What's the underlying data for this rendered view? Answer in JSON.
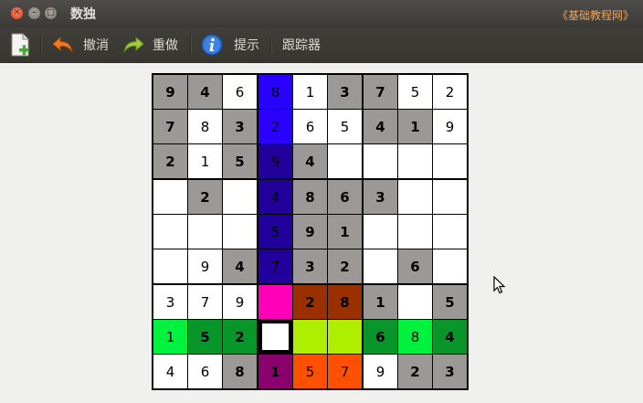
{
  "window": {
    "title": "数独",
    "link": "《基础教程网》"
  },
  "toolbar": {
    "undo_label": "撤消",
    "redo_label": "重做",
    "hint_label": "提示",
    "tracker_label": "跟踪器"
  },
  "icons": {
    "new": "new-document-icon",
    "undo": "undo-arrow-icon",
    "redo": "redo-arrow-icon",
    "hint": "info-icon"
  },
  "board": {
    "selected": [
      7,
      3
    ],
    "rows": [
      [
        {
          "v": "9",
          "g": true,
          "c": "#9c9895"
        },
        {
          "v": "4",
          "g": true,
          "c": "#9c9895"
        },
        {
          "v": "6",
          "g": false,
          "c": "#ffffff"
        },
        {
          "v": "8",
          "g": false,
          "c": "#2a00ff"
        },
        {
          "v": "1",
          "g": false,
          "c": "#ffffff"
        },
        {
          "v": "3",
          "g": true,
          "c": "#9c9895"
        },
        {
          "v": "7",
          "g": true,
          "c": "#9c9895"
        },
        {
          "v": "5",
          "g": false,
          "c": "#ffffff"
        },
        {
          "v": "2",
          "g": false,
          "c": "#ffffff"
        }
      ],
      [
        {
          "v": "7",
          "g": true,
          "c": "#9c9895"
        },
        {
          "v": "8",
          "g": false,
          "c": "#ffffff"
        },
        {
          "v": "3",
          "g": true,
          "c": "#9c9895"
        },
        {
          "v": "2",
          "g": false,
          "c": "#2a00ff"
        },
        {
          "v": "6",
          "g": false,
          "c": "#ffffff"
        },
        {
          "v": "5",
          "g": false,
          "c": "#ffffff"
        },
        {
          "v": "4",
          "g": true,
          "c": "#9c9895"
        },
        {
          "v": "1",
          "g": true,
          "c": "#9c9895"
        },
        {
          "v": "9",
          "g": false,
          "c": "#ffffff"
        }
      ],
      [
        {
          "v": "2",
          "g": true,
          "c": "#9c9895"
        },
        {
          "v": "1",
          "g": false,
          "c": "#ffffff"
        },
        {
          "v": "5",
          "g": true,
          "c": "#9c9895"
        },
        {
          "v": "9",
          "g": false,
          "c": "#22009c"
        },
        {
          "v": "4",
          "g": true,
          "c": "#9c9895"
        },
        {
          "v": "",
          "g": false,
          "c": "#ffffff"
        },
        {
          "v": "",
          "g": false,
          "c": "#ffffff"
        },
        {
          "v": "",
          "g": false,
          "c": "#ffffff"
        },
        {
          "v": "",
          "g": false,
          "c": "#ffffff"
        }
      ],
      [
        {
          "v": "",
          "g": false,
          "c": "#ffffff"
        },
        {
          "v": "2",
          "g": true,
          "c": "#9c9895"
        },
        {
          "v": "",
          "g": false,
          "c": "#ffffff"
        },
        {
          "v": "4",
          "g": false,
          "c": "#22009c"
        },
        {
          "v": "8",
          "g": true,
          "c": "#9c9895"
        },
        {
          "v": "6",
          "g": true,
          "c": "#9c9895"
        },
        {
          "v": "3",
          "g": true,
          "c": "#9c9895"
        },
        {
          "v": "",
          "g": false,
          "c": "#ffffff"
        },
        {
          "v": "",
          "g": false,
          "c": "#ffffff"
        }
      ],
      [
        {
          "v": "",
          "g": false,
          "c": "#ffffff"
        },
        {
          "v": "",
          "g": false,
          "c": "#ffffff"
        },
        {
          "v": "",
          "g": false,
          "c": "#ffffff"
        },
        {
          "v": "5",
          "g": false,
          "c": "#22009c"
        },
        {
          "v": "9",
          "g": true,
          "c": "#9c9895"
        },
        {
          "v": "1",
          "g": true,
          "c": "#9c9895"
        },
        {
          "v": "",
          "g": false,
          "c": "#ffffff"
        },
        {
          "v": "",
          "g": false,
          "c": "#ffffff"
        },
        {
          "v": "",
          "g": false,
          "c": "#ffffff"
        }
      ],
      [
        {
          "v": "",
          "g": false,
          "c": "#ffffff"
        },
        {
          "v": "9",
          "g": false,
          "c": "#ffffff"
        },
        {
          "v": "4",
          "g": true,
          "c": "#9c9895"
        },
        {
          "v": "7",
          "g": false,
          "c": "#22009c"
        },
        {
          "v": "3",
          "g": true,
          "c": "#9c9895"
        },
        {
          "v": "2",
          "g": true,
          "c": "#9c9895"
        },
        {
          "v": "",
          "g": false,
          "c": "#ffffff"
        },
        {
          "v": "6",
          "g": true,
          "c": "#9c9895"
        },
        {
          "v": "",
          "g": false,
          "c": "#ffffff"
        }
      ],
      [
        {
          "v": "3",
          "g": false,
          "c": "#ffffff"
        },
        {
          "v": "7",
          "g": false,
          "c": "#ffffff"
        },
        {
          "v": "9",
          "g": false,
          "c": "#ffffff"
        },
        {
          "v": "",
          "g": false,
          "c": "#ff00b8"
        },
        {
          "v": "2",
          "g": true,
          "c": "#9a3000"
        },
        {
          "v": "8",
          "g": true,
          "c": "#9a3000"
        },
        {
          "v": "1",
          "g": true,
          "c": "#9c9895"
        },
        {
          "v": "",
          "g": false,
          "c": "#ffffff"
        },
        {
          "v": "5",
          "g": true,
          "c": "#9c9895"
        }
      ],
      [
        {
          "v": "1",
          "g": false,
          "c": "#00f23e"
        },
        {
          "v": "5",
          "g": true,
          "c": "#08952a"
        },
        {
          "v": "2",
          "g": true,
          "c": "#08952a"
        },
        {
          "v": "",
          "g": false,
          "c": "#ffffff"
        },
        {
          "v": "",
          "g": false,
          "c": "#aeee00"
        },
        {
          "v": "",
          "g": false,
          "c": "#aeee00"
        },
        {
          "v": "6",
          "g": true,
          "c": "#08952a"
        },
        {
          "v": "8",
          "g": false,
          "c": "#00f23e"
        },
        {
          "v": "4",
          "g": true,
          "c": "#08952a"
        }
      ],
      [
        {
          "v": "4",
          "g": false,
          "c": "#ffffff"
        },
        {
          "v": "6",
          "g": false,
          "c": "#ffffff"
        },
        {
          "v": "8",
          "g": true,
          "c": "#9c9895"
        },
        {
          "v": "1",
          "g": true,
          "c": "#8a006c"
        },
        {
          "v": "5",
          "g": false,
          "c": "#ff5000"
        },
        {
          "v": "7",
          "g": false,
          "c": "#ff5000"
        },
        {
          "v": "9",
          "g": false,
          "c": "#ffffff"
        },
        {
          "v": "2",
          "g": true,
          "c": "#9c9895"
        },
        {
          "v": "3",
          "g": true,
          "c": "#9c9895"
        }
      ]
    ]
  }
}
